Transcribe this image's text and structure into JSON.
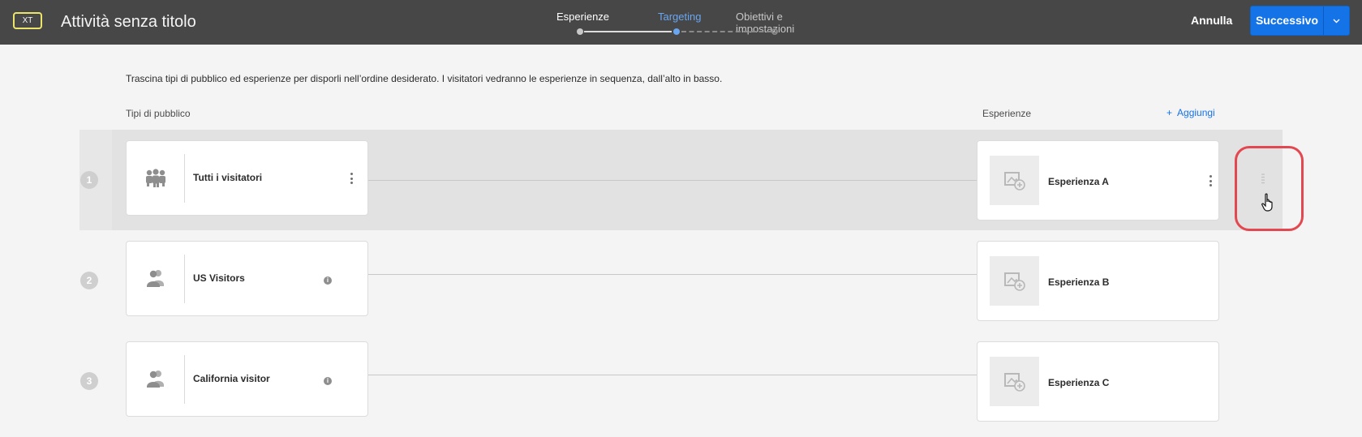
{
  "header": {
    "badge": "XT",
    "title": "Attività senza titolo",
    "steps": [
      {
        "label": "Esperienze",
        "state": "done"
      },
      {
        "label": "Targeting",
        "state": "current"
      },
      {
        "label": "Obiettivi e impostazioni",
        "state": "upcoming"
      }
    ],
    "cancel_label": "Annulla",
    "next_label": "Successivo"
  },
  "content": {
    "instructions": "Trascina tipi di pubblico ed esperienze per disporli nell’ordine desiderato. I visitatori vedranno le esperienze in sequenza, dall’alto in basso.",
    "audiences_header": "Tipi di pubblico",
    "experiences_header": "Esperienze",
    "add_label": "Aggiungi",
    "add_symbol": "+",
    "rows": [
      {
        "number": "1",
        "audience": "Tutti i visitatori",
        "audience_icon": "group-icon",
        "audience_action": "more-icon",
        "experience": "Esperienza A",
        "experience_action": "more-icon",
        "selected": true
      },
      {
        "number": "2",
        "audience": "US Visitors",
        "audience_icon": "user-group-icon",
        "audience_action": "info-icon",
        "experience": "Esperienza B"
      },
      {
        "number": "3",
        "audience": "California visitor",
        "audience_icon": "user-group-icon",
        "audience_action": "info-icon",
        "experience": "Esperienza C"
      }
    ],
    "info_symbol": "i"
  },
  "colors": {
    "header_bg": "#474747",
    "accent": "#1473e6",
    "active_step": "#6aa6f0",
    "badge_border": "#ece46a",
    "highlight": "#e34850"
  }
}
